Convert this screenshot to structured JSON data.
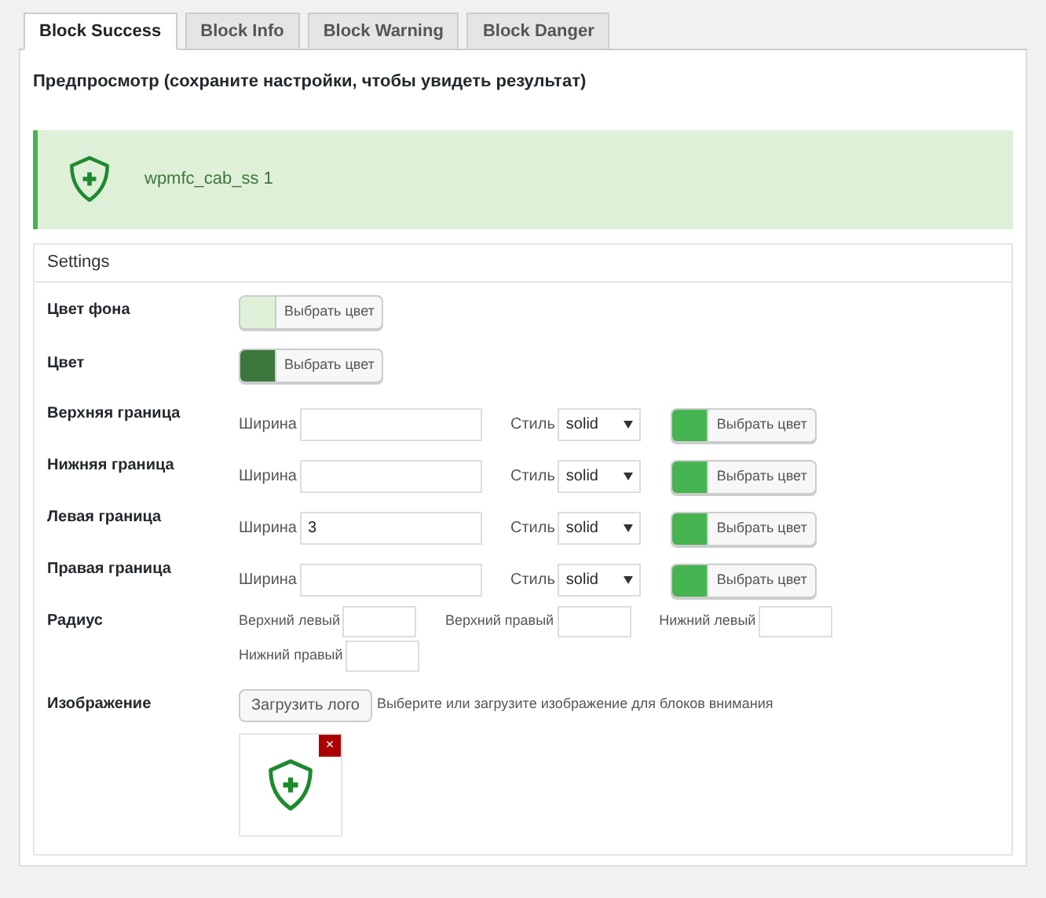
{
  "tabs": [
    {
      "label": "Block Success",
      "selected": true
    },
    {
      "label": "Block Info",
      "selected": false
    },
    {
      "label": "Block Warning",
      "selected": false
    },
    {
      "label": "Block Danger",
      "selected": false
    }
  ],
  "preview": {
    "heading": "Предпросмотр (сохраните настройки, чтобы увидеть результат)",
    "text": "wpmfc_cab_ss 1"
  },
  "settings": {
    "title": "Settings",
    "colors": [
      {
        "label": "Цвет фона",
        "button": "Выбрать цвет",
        "color": "#dff0d8"
      },
      {
        "label": "Цвет",
        "button": "Выбрать цвет",
        "color": "#3c763d"
      }
    ],
    "borders": [
      {
        "label": "Верхняя граница",
        "width_label": "Ширина",
        "style_label": "Стиль",
        "style": "solid",
        "button": "Выбрать цвет",
        "color": "#46b450"
      },
      {
        "label": "Нижняя граница",
        "width_label": "Ширина",
        "style_label": "Стиль",
        "style": "solid",
        "button": "Выбрать цвет",
        "color": "#46b450"
      },
      {
        "label": "Левая граница",
        "width_label": "Ширина",
        "value": "3",
        "style_label": "Стиль",
        "style": "solid",
        "button": "Выбрать цвет",
        "color": "#46b450"
      },
      {
        "label": "Правая граница",
        "width_label": "Ширина",
        "style_label": "Стиль",
        "style": "solid",
        "button": "Выбрать цвет",
        "color": "#46b450"
      }
    ],
    "radius": {
      "label": "Радиус",
      "fields": [
        {
          "label": "Верхний левый"
        },
        {
          "label": "Верхний правый"
        },
        {
          "label": "Нижний левый"
        },
        {
          "label": "Нижний правый"
        }
      ]
    },
    "image": {
      "label": "Изображение",
      "button": "Загрузить лого",
      "hint": "Выберите или загрузите изображение для блоков внимания",
      "remove": "×"
    }
  }
}
